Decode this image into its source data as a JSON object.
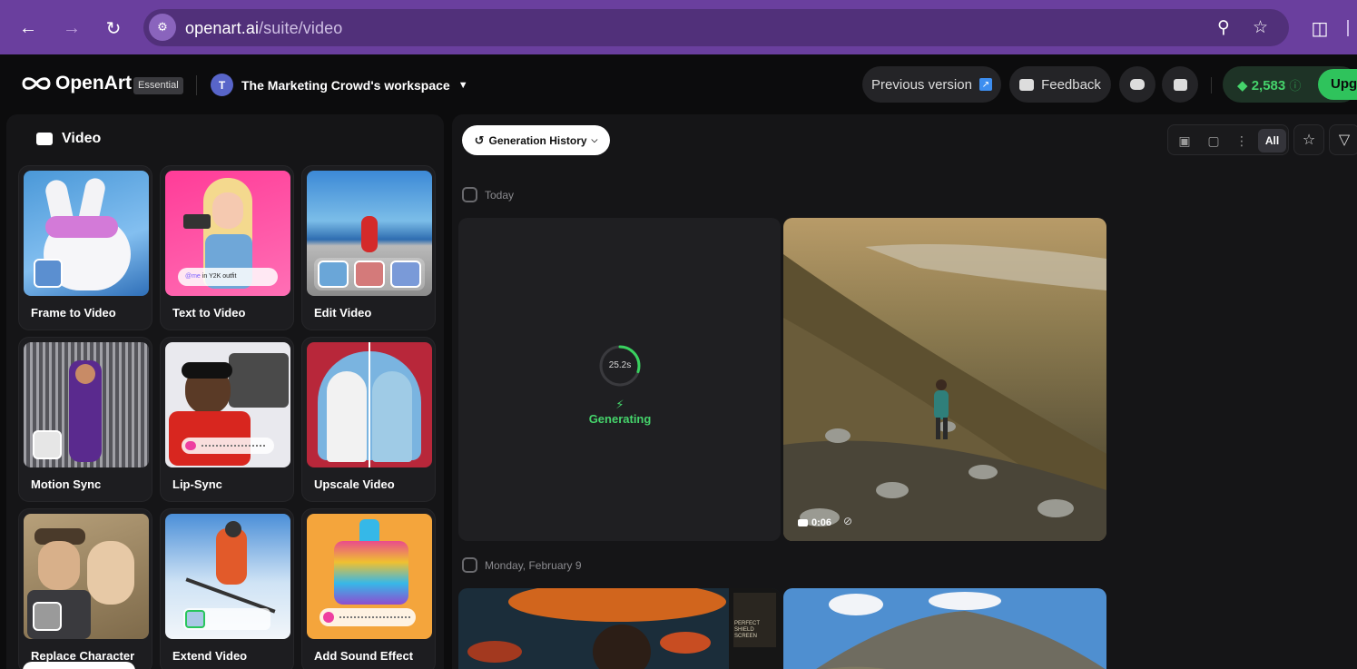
{
  "browser": {
    "url_host": "openart.ai",
    "url_path": "/suite/video"
  },
  "header": {
    "brand": "OpenArt",
    "plan_badge": "Essential",
    "workspace_initial": "T",
    "workspace_name": "The Marketing Crowd's workspace",
    "previous_version": "Previous version",
    "feedback": "Feedback",
    "credits": "2,583",
    "upgrade": "Upgr"
  },
  "sidebar": {
    "title": "Video",
    "tools": [
      {
        "label": "Frame to Video"
      },
      {
        "label": "Text to Video",
        "chip": "in Y2K outfit",
        "chip_mention": "@me"
      },
      {
        "label": "Edit Video"
      },
      {
        "label": "Motion Sync"
      },
      {
        "label": "Lip-Sync"
      },
      {
        "label": "Upscale Video"
      },
      {
        "label": "Replace Character"
      },
      {
        "label": "Extend Video"
      },
      {
        "label": "Add Sound Effect"
      }
    ]
  },
  "main": {
    "history_button": "Generation History",
    "filter_all": "All",
    "groups": [
      {
        "date": "Today"
      },
      {
        "date": "Monday, February 9"
      }
    ],
    "generating": {
      "timer": "25.2s",
      "status": "Generating",
      "progress": 0.3
    },
    "video_item": {
      "duration": "0:06"
    },
    "second_group_poster_text": "PERFECT SHIELD SCREEN"
  },
  "colors": {
    "browser_bar": "#6a3f9e",
    "accent_green": "#45d36b",
    "panel": "#151517"
  }
}
